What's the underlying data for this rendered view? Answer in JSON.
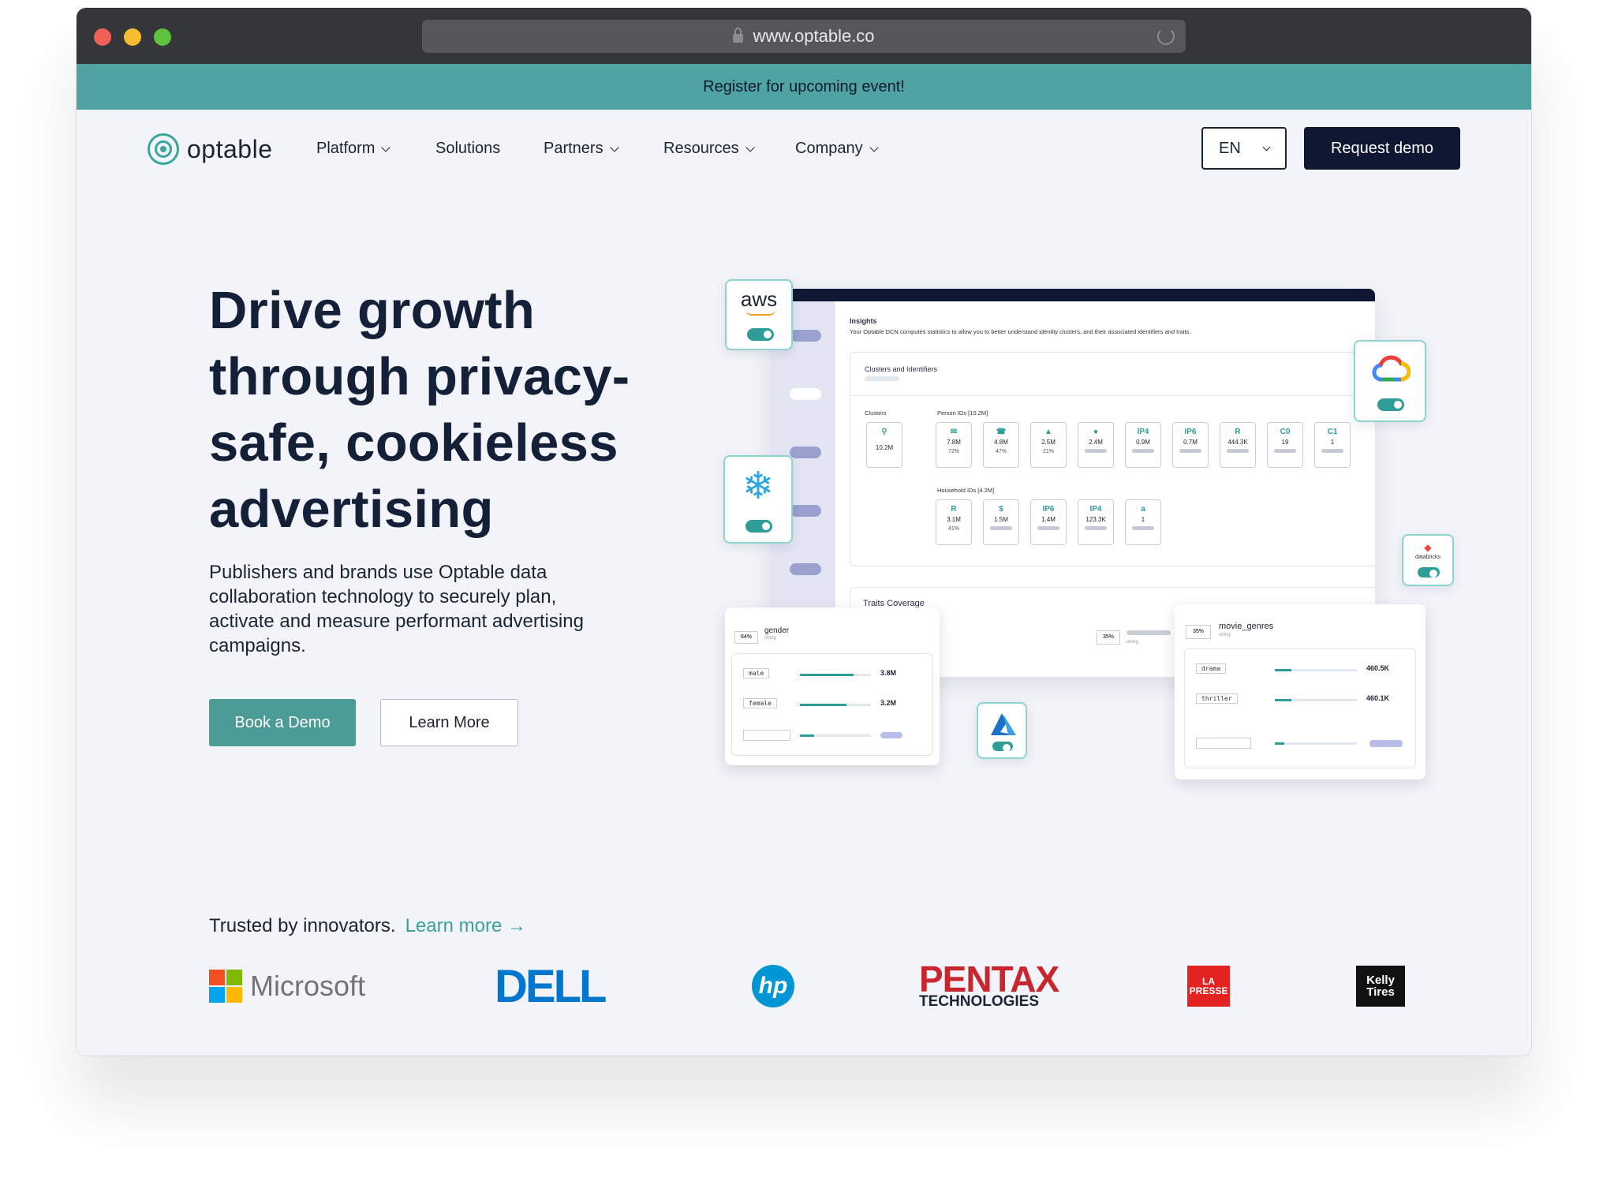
{
  "browser": {
    "url": "www.optable.co"
  },
  "banner": {
    "text": "Register for upcoming event!"
  },
  "nav": {
    "logo": "optable",
    "items": [
      "Platform",
      "Solutions",
      "Partners",
      "Resources",
      "Company"
    ],
    "language": "EN",
    "request_demo": "Request demo"
  },
  "hero": {
    "title": "Drive growth through privacy-safe, cookieless advertising",
    "subtitle": "Publishers and brands use Optable data collaboration technology to securely plan, activate and measure performant advertising campaigns.",
    "book_demo": "Book a Demo",
    "learn_more": "Learn More"
  },
  "trusted": {
    "text": "Trusted by innovators.",
    "link": "Learn more →"
  },
  "brands": [
    "Microsoft",
    "DELL",
    "hp",
    "PENTAX",
    "TECHNOLOGIES",
    "LA PRESSE",
    "Kelly Tires"
  ],
  "illustration": {
    "insights_title": "Insights",
    "insights_desc": "Your Optable DCN computes statistics to allow you to better understand identity clusters, and their associated identifiers and traits.",
    "clusters_heading": "Clusters and Identifiers",
    "clusters_label": "Clusters",
    "person_ids": "Person IDs [10.2M]",
    "household_ids": "Household IDs [4.2M]",
    "cluster_value": "10.2M",
    "person_boxes": [
      {
        "icon": "✉",
        "value": "7.8M",
        "pct": "72%"
      },
      {
        "icon": "☎",
        "value": "4.8M",
        "pct": "47%"
      },
      {
        "icon": "▲",
        "value": "2.5M",
        "pct": "21%"
      },
      {
        "icon": "●",
        "value": "2.4M",
        "pct": ""
      },
      {
        "icon": "IP4",
        "value": "0.9M",
        "pct": ""
      },
      {
        "icon": "IP6",
        "value": "0.7M",
        "pct": ""
      },
      {
        "icon": "R",
        "value": "444.3K",
        "pct": ""
      },
      {
        "icon": "C0",
        "value": "19",
        "pct": ""
      },
      {
        "icon": "C1",
        "value": "1",
        "pct": ""
      }
    ],
    "household_boxes": [
      {
        "icon": "R",
        "value": "3.1M",
        "pct": "41%"
      },
      {
        "icon": "$",
        "value": "1.5M",
        "pct": ""
      },
      {
        "icon": "IP6",
        "value": "1.4M",
        "pct": ""
      },
      {
        "icon": "IP4",
        "value": "123.3K",
        "pct": ""
      },
      {
        "icon": "a",
        "value": "1",
        "pct": ""
      }
    ],
    "traits_coverage": "Traits Coverage",
    "traits_pct": "35%",
    "traits_string": "string",
    "gender_card": {
      "pct": "64%",
      "name": "gender",
      "type": "string",
      "rows": [
        {
          "label": "male",
          "value": "3.8M",
          "fill": 0.75
        },
        {
          "label": "female",
          "value": "3.2M",
          "fill": 0.65
        }
      ]
    },
    "movie_card": {
      "pct": "35%",
      "name": "movie_genres",
      "type": "string",
      "rows": [
        {
          "label": "drama",
          "value": "460.5K",
          "fill": 0.2
        },
        {
          "label": "thriller",
          "value": "460.1K",
          "fill": 0.2
        }
      ]
    },
    "integrations": [
      "aws",
      "google-cloud",
      "snowflake",
      "databricks",
      "azure"
    ],
    "databricks_label": "databricks"
  },
  "colors": {
    "teal": "#4b9b97",
    "navy": "#0f1733",
    "banner": "#4fa3a1",
    "accent": "#3aa19c"
  }
}
